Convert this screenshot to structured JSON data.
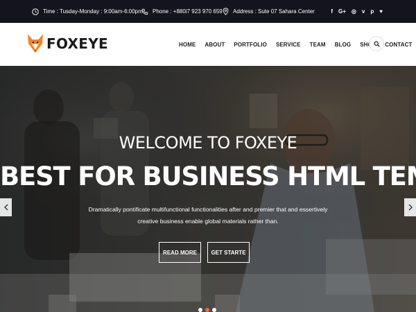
{
  "topbar": {
    "time": "Time : Tusday-Monday : 9:00am-6:00pm",
    "phone": "Phone : +880i7 923 970 659",
    "address": "Address : Sute 07 Sahara Center",
    "social": [
      {
        "name": "facebook",
        "glyph": "f"
      },
      {
        "name": "google-plus",
        "glyph": "G+"
      },
      {
        "name": "dribbble",
        "glyph": "◎"
      },
      {
        "name": "vimeo",
        "glyph": "v"
      },
      {
        "name": "pinterest",
        "glyph": "p"
      },
      {
        "name": "heart",
        "glyph": "♥"
      }
    ]
  },
  "header": {
    "logo_text": "FOXEYE",
    "nav": [
      "HOME",
      "ABOUT",
      "PORTFOLIO",
      "SERVICE",
      "TEAM",
      "BLOG",
      "SHOP",
      "CONTACT"
    ]
  },
  "hero": {
    "title": "WELCOME TO FOXEYE",
    "headline": "BEST FOR BUSINESS HTML TEMPLATE",
    "description_line1": "Dramatically pontificate multifunctional functionalities after and premier that and essertively",
    "description_line2": "creative business enable global materials rather than.",
    "buttons": {
      "read_more": "READ MORE",
      "get_started": "GET STARTE"
    },
    "slider": {
      "active_dot": 1,
      "dot_count": 3
    }
  },
  "colors": {
    "topbar_bg": "#13141d",
    "accent": "#ff6a2b",
    "logo_orange": "#f5821f"
  }
}
